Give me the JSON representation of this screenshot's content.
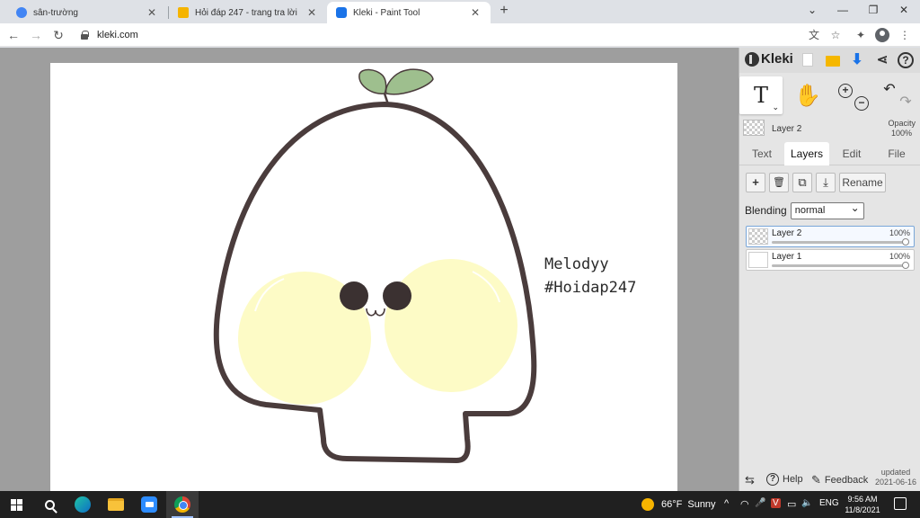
{
  "browser": {
    "tabs": [
      {
        "title": "sân-trường",
        "favicon_color": "#4285f4",
        "active": false
      },
      {
        "title": "Hỏi đáp 247 - trang tra lời",
        "favicon_color": "#f5b400",
        "active": false
      },
      {
        "title": "Kleki - Paint Tool",
        "favicon_color": "#1a73e8",
        "active": true
      }
    ],
    "close_glyph": "✕",
    "new_tab_glyph": "+",
    "window_controls": {
      "chevron": "⌄",
      "minimize": "—",
      "restore": "❐",
      "close": "✕"
    },
    "nav": {
      "back": "←",
      "forward": "→",
      "reload": "↻"
    },
    "url": "kleki.com",
    "toolbar_icons": {
      "translate": "文",
      "bookmark": "☆",
      "extensions": "✦",
      "menu": "⋮"
    }
  },
  "canvas": {
    "signature_line1": "Melodyy",
    "signature_line2": "#Hoidap247",
    "colors": {
      "outline": "#4a3c3c",
      "cheek": "#fdfbc6",
      "sprout": "#9ebf8e"
    }
  },
  "kleki": {
    "brand": "Kleki",
    "header_icons": {
      "share": "⋖",
      "help": "?"
    },
    "tools": {
      "text": "T",
      "caret": "⌄",
      "hand": "✋",
      "zoom_in": "+",
      "zoom_out": "−",
      "undo": "↶",
      "redo": "↷"
    },
    "current_layer": "Layer 2",
    "opacity_label": "Opacity",
    "opacity_value": "100%",
    "tabs": [
      "Text",
      "Layers",
      "Edit",
      "File"
    ],
    "active_tab": "Layers",
    "action_icons": {
      "add": "+",
      "delete": "🗑",
      "duplicate": "⧉",
      "merge": "⤓"
    },
    "rename_label": "Rename",
    "blending_label": "Blending",
    "blending_value": "normal",
    "layers": [
      {
        "name": "Layer 2",
        "opacity": "100%",
        "opacity_fraction": 1.0,
        "active": true
      },
      {
        "name": "Layer 1",
        "opacity": "100%",
        "opacity_fraction": 1.0,
        "active": false
      }
    ],
    "footer": {
      "swap_icon": "⇆",
      "help_glyph": "?",
      "help_label": "Help",
      "feedback_icon": "✎",
      "feedback_label": "Feedback",
      "updated_label": "updated",
      "updated_date": "2021-06-16"
    }
  },
  "taskbar": {
    "weather_temp": "66°F",
    "weather_text": "Sunny",
    "tray": {
      "chevron": "^",
      "wifi": "◠",
      "mic": "🎤",
      "v": "V",
      "battery": "▭",
      "volume": "🔈"
    },
    "language": "ENG",
    "time": "9:56 AM",
    "date": "11/8/2021"
  }
}
